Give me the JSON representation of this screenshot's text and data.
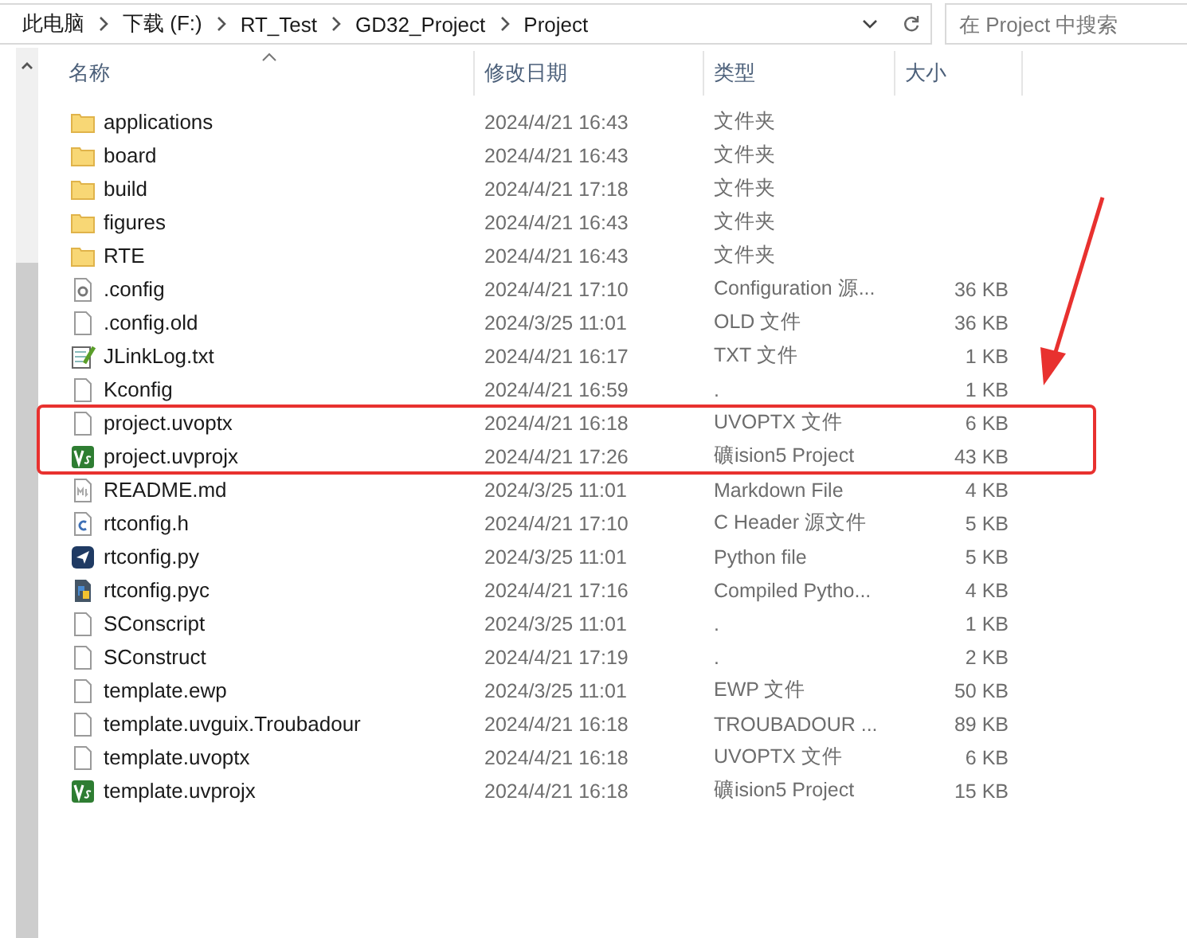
{
  "address_bar": {
    "crumbs": [
      "此电脑",
      "下载 (F:)",
      "RT_Test",
      "GD32_Project",
      "Project"
    ]
  },
  "search": {
    "placeholder": "在 Project 中搜索"
  },
  "columns": [
    {
      "label": "名称",
      "sorted": true
    },
    {
      "label": "修改日期",
      "sorted": false
    },
    {
      "label": "类型",
      "sorted": false
    },
    {
      "label": "大小",
      "sorted": false
    }
  ],
  "rows": [
    {
      "kind": "folder",
      "name": "applications",
      "modified": "2024/4/21 16:43",
      "type": "文件夹",
      "highlighted": false
    },
    {
      "kind": "folder",
      "name": "board",
      "modified": "2024/4/21 16:43",
      "type": "文件夹",
      "highlighted": false
    },
    {
      "kind": "folder",
      "name": "build",
      "modified": "2024/4/21 17:18",
      "type": "文件夹",
      "highlighted": false
    },
    {
      "kind": "folder",
      "name": "figures",
      "modified": "2024/4/21 16:43",
      "type": "文件夹",
      "highlighted": false
    },
    {
      "kind": "folder",
      "name": "RTE",
      "modified": "2024/4/21 16:43",
      "type": "文件夹",
      "highlighted": false
    },
    {
      "kind": "config",
      "name": ".config",
      "modified": "2024/4/21 17:10",
      "type": "Configuration 源...",
      "size": "36 KB",
      "highlighted": false
    },
    {
      "kind": "blank",
      "name": ".config.old",
      "modified": "2024/3/25 11:01",
      "type": "OLD 文件",
      "size": "36 KB",
      "highlighted": false
    },
    {
      "kind": "text",
      "name": "JLinkLog.txt",
      "modified": "2024/4/21 16:17",
      "type": "TXT 文件",
      "size": "1 KB",
      "highlighted": false
    },
    {
      "kind": "blank",
      "name": "Kconfig",
      "modified": "2024/4/21 16:59",
      "type": ".",
      "size": "1 KB",
      "highlighted": false
    },
    {
      "kind": "blank",
      "name": "project.uvoptx",
      "modified": "2024/4/21 16:18",
      "type": "UVOPTX 文件",
      "size": "6 KB",
      "highlighted": true
    },
    {
      "kind": "keil",
      "name": "project.uvprojx",
      "modified": "2024/4/21 17:26",
      "type": "礦ision5 Project",
      "size": "43 KB",
      "highlighted": true
    },
    {
      "kind": "markdown",
      "name": "README.md",
      "modified": "2024/3/25 11:01",
      "type": "Markdown File",
      "size": "4 KB",
      "highlighted": false
    },
    {
      "kind": "c_header",
      "name": "rtconfig.h",
      "modified": "2024/4/21 17:10",
      "type": "C Header 源文件",
      "size": "5 KB",
      "highlighted": false
    },
    {
      "kind": "python",
      "name": "rtconfig.py",
      "modified": "2024/3/25 11:01",
      "type": "Python file",
      "size": "5 KB",
      "highlighted": false
    },
    {
      "kind": "python_compiled",
      "name": "rtconfig.pyc",
      "modified": "2024/4/21 17:16",
      "type": "Compiled Pytho...",
      "size": "4 KB",
      "highlighted": false
    },
    {
      "kind": "blank",
      "name": "SConscript",
      "modified": "2024/3/25 11:01",
      "type": ".",
      "size": "1 KB",
      "highlighted": false
    },
    {
      "kind": "blank",
      "name": "SConstruct",
      "modified": "2024/4/21 17:19",
      "type": ".",
      "size": "2 KB",
      "highlighted": false
    },
    {
      "kind": "blank",
      "name": "template.ewp",
      "modified": "2024/3/25 11:01",
      "type": "EWP 文件",
      "size": "50 KB",
      "highlighted": false
    },
    {
      "kind": "blank",
      "name": "template.uvguix.Troubadour",
      "modified": "2024/4/21 16:18",
      "type": "TROUBADOUR ...",
      "size": "89 KB",
      "highlighted": false
    },
    {
      "kind": "blank",
      "name": "template.uvoptx",
      "modified": "2024/4/21 16:18",
      "type": "UVOPTX 文件",
      "size": "6 KB",
      "highlighted": false
    },
    {
      "kind": "keil",
      "name": "template.uvprojx",
      "modified": "2024/4/21 16:18",
      "type": "礦ision5 Project",
      "size": "15 KB",
      "highlighted": false
    }
  ]
}
